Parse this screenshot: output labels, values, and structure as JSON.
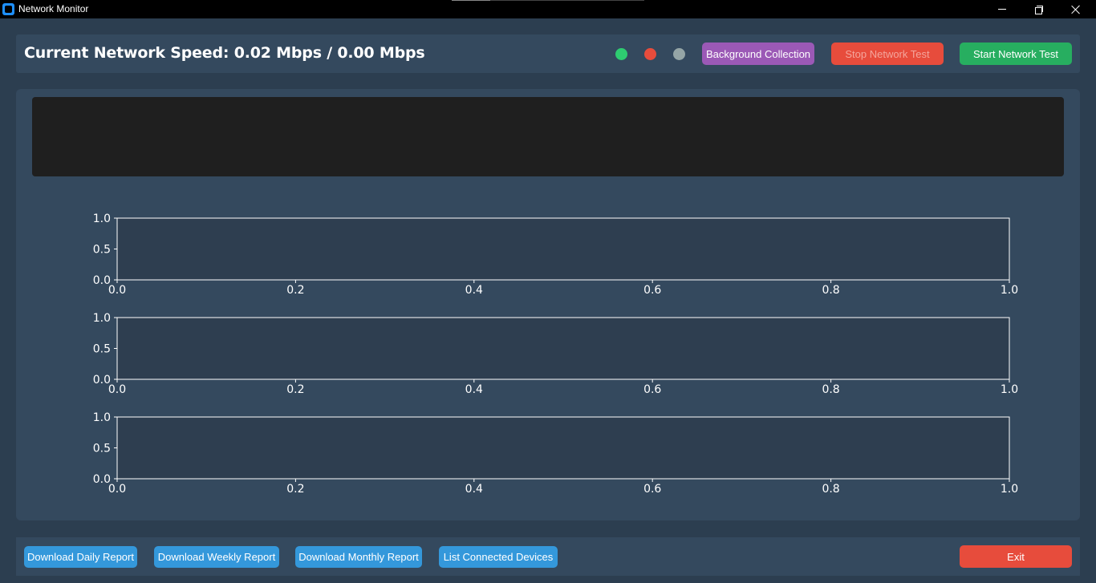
{
  "window": {
    "title": "Network Monitor"
  },
  "header": {
    "speed_text": "Current Network Speed: 0.02 Mbps / 0.00 Mbps",
    "indicators": [
      {
        "name": "green-status-indicator",
        "color": "#2ecc71"
      },
      {
        "name": "red-status-indicator",
        "color": "#e74c3c"
      },
      {
        "name": "gray-status-indicator",
        "color": "#95a5a6"
      }
    ],
    "buttons": {
      "background_collection": "Background Collection",
      "stop_test": "Stop Network Test",
      "start_test": "Start Network Test"
    }
  },
  "footer": {
    "buttons": {
      "daily": "Download Daily Report",
      "weekly": "Download Weekly Report",
      "monthly": "Download Monthly Report",
      "devices": "List Connected Devices",
      "exit": "Exit"
    }
  },
  "colors": {
    "background": "#2c3e50",
    "panel": "#34495e",
    "plot_area": "#2e3e50",
    "log_box": "#1f1f1f",
    "purple": "#9b59b6",
    "red": "#e74c3c",
    "green": "#27ae60",
    "blue": "#3498db"
  },
  "chart_data": [
    {
      "type": "line",
      "x": [],
      "y": [],
      "xlim": [
        0.0,
        1.0
      ],
      "ylim": [
        0.0,
        1.0
      ],
      "xticks": [
        "0.0",
        "0.2",
        "0.4",
        "0.6",
        "0.8",
        "1.0"
      ],
      "yticks": [
        "0.0",
        "0.5",
        "1.0"
      ],
      "title": "",
      "xlabel": "",
      "ylabel": "",
      "grid": false
    },
    {
      "type": "line",
      "x": [],
      "y": [],
      "xlim": [
        0.0,
        1.0
      ],
      "ylim": [
        0.0,
        1.0
      ],
      "xticks": [
        "0.0",
        "0.2",
        "0.4",
        "0.6",
        "0.8",
        "1.0"
      ],
      "yticks": [
        "0.0",
        "0.5",
        "1.0"
      ],
      "title": "",
      "xlabel": "",
      "ylabel": "",
      "grid": false
    },
    {
      "type": "line",
      "x": [],
      "y": [],
      "xlim": [
        0.0,
        1.0
      ],
      "ylim": [
        0.0,
        1.0
      ],
      "xticks": [
        "0.0",
        "0.2",
        "0.4",
        "0.6",
        "0.8",
        "1.0"
      ],
      "yticks": [
        "0.0",
        "0.5",
        "1.0"
      ],
      "title": "",
      "xlabel": "",
      "ylabel": "",
      "grid": false
    }
  ]
}
